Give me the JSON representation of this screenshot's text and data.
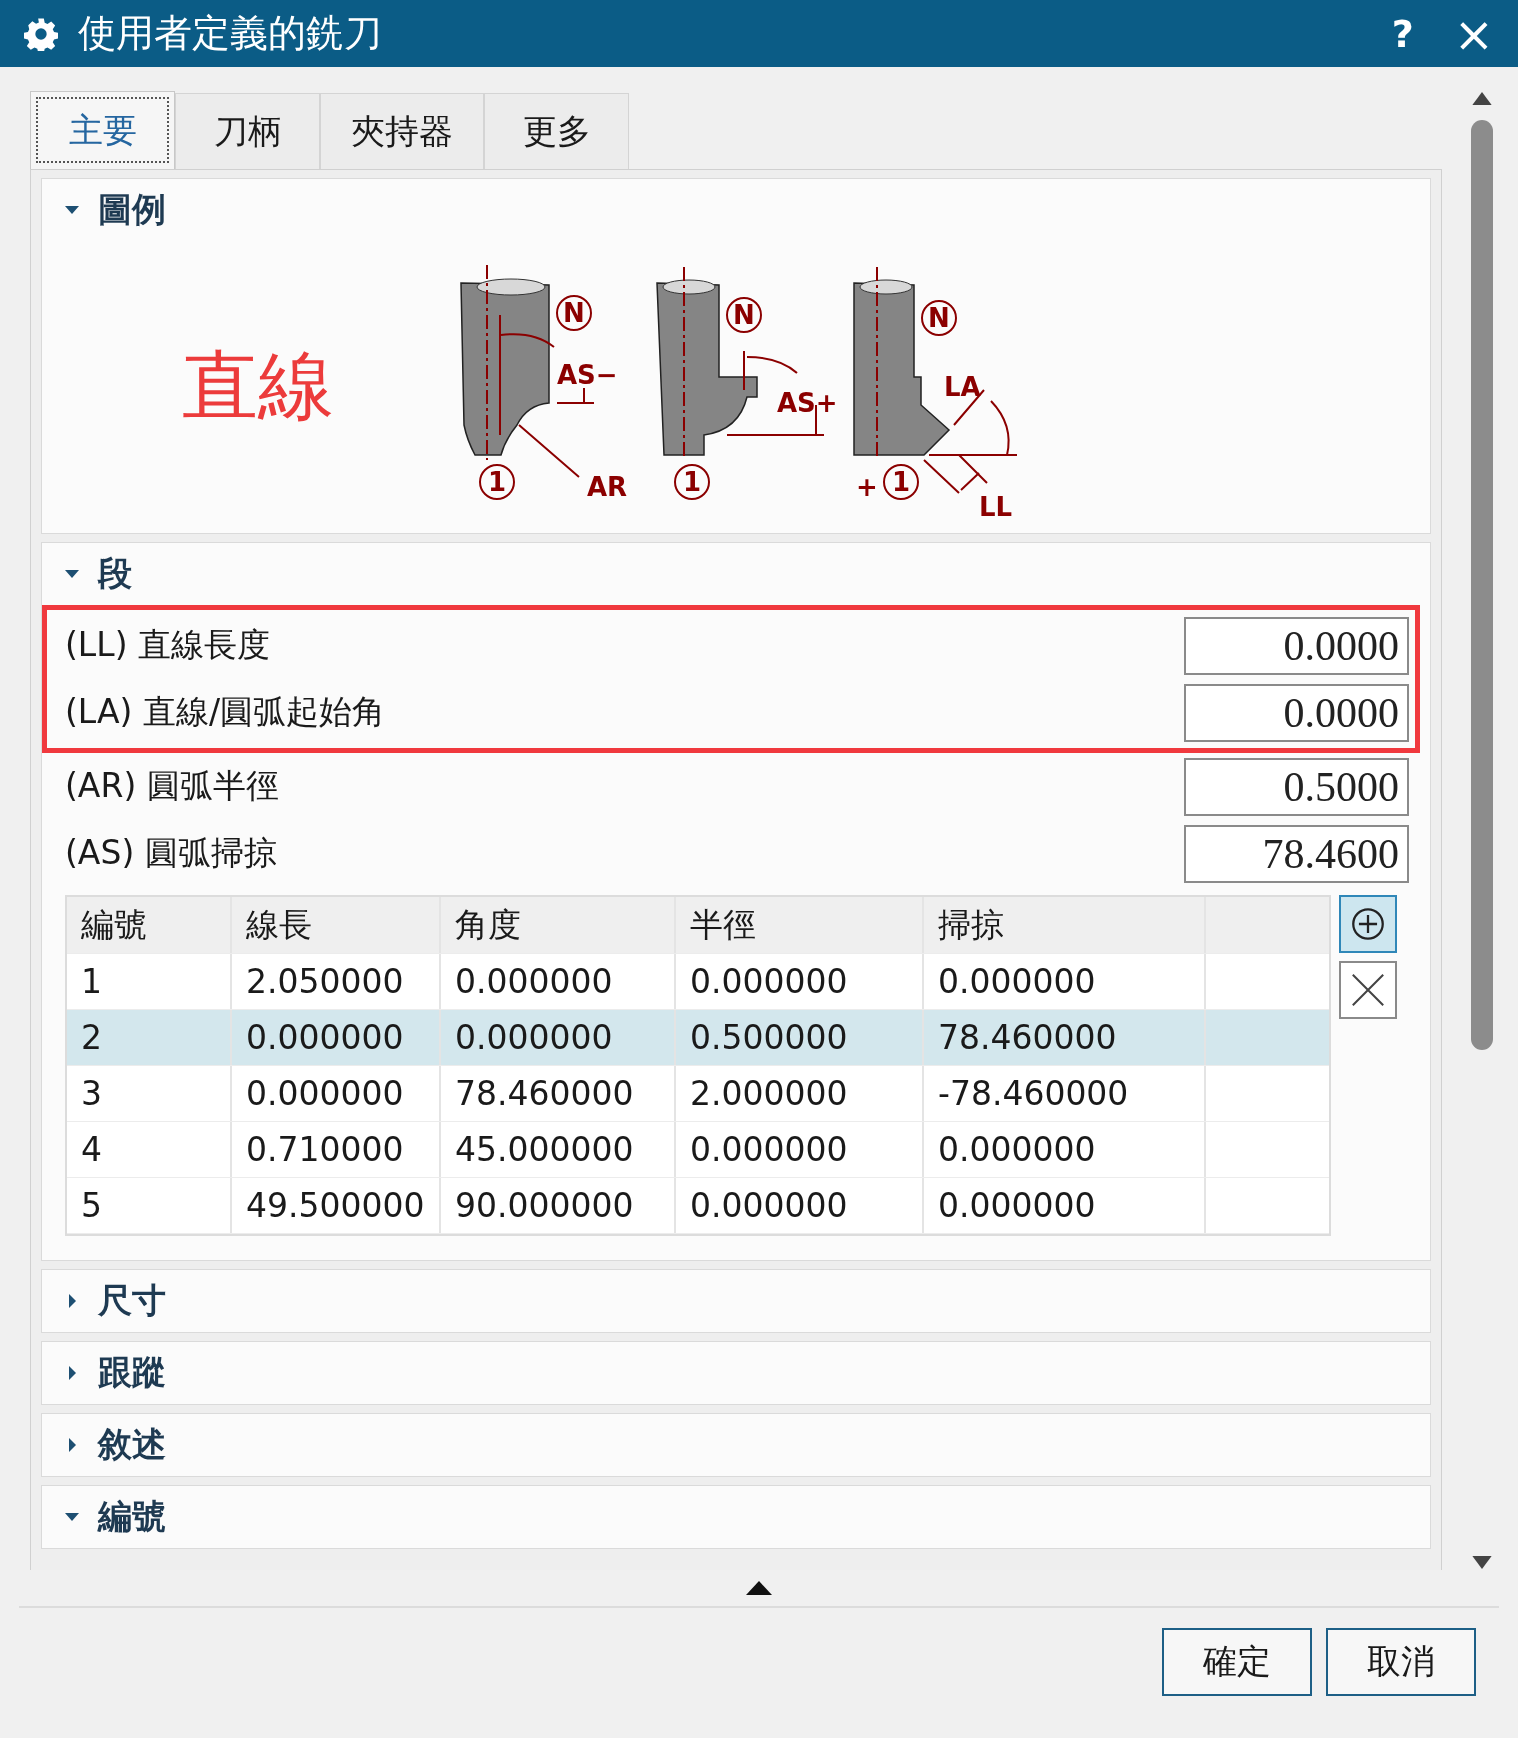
{
  "window": {
    "title": "使用者定義的銑刀",
    "help": "?",
    "close": "×"
  },
  "tabs": [
    {
      "label": "主要",
      "selected": true
    },
    {
      "label": "刀柄",
      "selected": false
    },
    {
      "label": "夾持器",
      "selected": false
    },
    {
      "label": "更多",
      "selected": false
    }
  ],
  "sections": [
    {
      "title": "圖例",
      "expanded": true,
      "kind": "legend",
      "caption": "直線",
      "labels": [
        "N",
        "AS−",
        "1",
        "AR",
        "N",
        "AS+",
        "1",
        "N",
        "LA",
        "+",
        "1",
        "LL"
      ]
    },
    {
      "title": "段",
      "expanded": true,
      "kind": "segments",
      "params": [
        {
          "label": "(LL) 直線長度",
          "value": "0.0000",
          "highlighted": true
        },
        {
          "label": "(LA) 直線/圓弧起始角",
          "value": "0.0000",
          "highlighted": true
        },
        {
          "label": "(AR) 圓弧半徑",
          "value": "0.5000",
          "highlighted": false
        },
        {
          "label": "(AS) 圓弧掃掠",
          "value": "78.4600",
          "highlighted": false
        }
      ],
      "table": {
        "columns": [
          "編號",
          "線長",
          "角度",
          "半徑",
          "掃掠"
        ],
        "rows": [
          {
            "cells": [
              "1",
              "2.050000",
              "0.000000",
              "0.000000",
              "0.000000"
            ],
            "selected": false
          },
          {
            "cells": [
              "2",
              "0.000000",
              "0.000000",
              "0.500000",
              "78.460000"
            ],
            "selected": true
          },
          {
            "cells": [
              "3",
              "0.000000",
              "78.460000",
              "2.000000",
              "-78.460000"
            ],
            "selected": false
          },
          {
            "cells": [
              "4",
              "0.710000",
              "45.000000",
              "0.000000",
              "0.000000"
            ],
            "selected": false
          },
          {
            "cells": [
              "5",
              "49.500000",
              "90.000000",
              "0.000000",
              "0.000000"
            ],
            "selected": false
          }
        ]
      }
    },
    {
      "title": "尺寸",
      "expanded": false
    },
    {
      "title": "跟蹤",
      "expanded": false
    },
    {
      "title": "敘述",
      "expanded": false
    },
    {
      "title": "編號",
      "expanded": true
    }
  ],
  "buttons": [
    {
      "label": "確定"
    },
    {
      "label": "取消"
    }
  ]
}
